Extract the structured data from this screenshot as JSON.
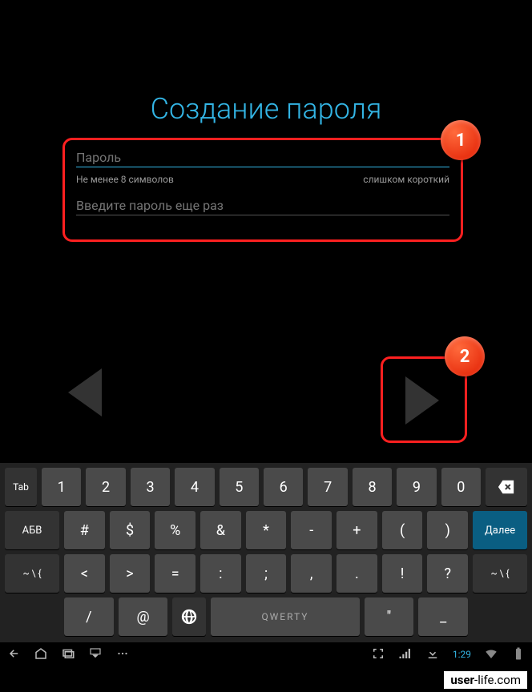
{
  "title": "Создание пароля",
  "annotations": {
    "badge1": "1",
    "badge2": "2"
  },
  "form": {
    "password_placeholder": "Пароль",
    "hint_left": "Не менее 8 символов",
    "hint_right": "слишком короткий",
    "confirm_placeholder": "Введите пароль еще раз"
  },
  "keyboard": {
    "row1_side": "Tab",
    "row1": [
      "1",
      "2",
      "3",
      "4",
      "5",
      "6",
      "7",
      "8",
      "9",
      "0"
    ],
    "row2_side": "АБВ",
    "row2": [
      "#",
      "$",
      "%",
      "&",
      "*",
      "-",
      "+",
      "(",
      ")"
    ],
    "row2_end": "Далее",
    "row3_side": "~ \\ {",
    "row3": [
      "<",
      ">",
      "=",
      ":",
      ";",
      ",",
      ".",
      "!",
      "?"
    ],
    "row3_end": "~ \\ {",
    "row4": {
      "slash": "/",
      "at": "@",
      "space": "QWERTY",
      "quote": "\"",
      "under": "_"
    }
  },
  "statusbar": {
    "time": "1:29"
  },
  "watermark": {
    "bold": "user",
    "rest": "-life.com"
  }
}
